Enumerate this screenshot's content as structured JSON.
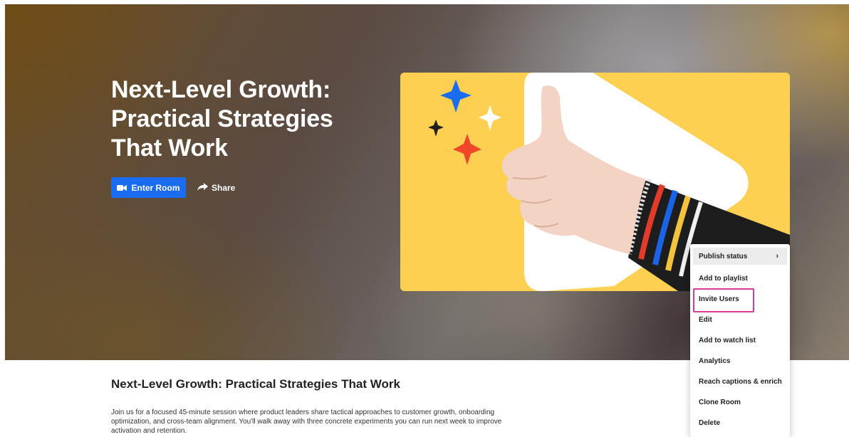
{
  "hero": {
    "title": "Next-Level Growth: Practical Strategies That Work",
    "enter_label": "Enter Room",
    "share_label": "Share"
  },
  "description": {
    "title": "Next-Level Growth: Practical Strategies That Work",
    "text": "Join us for a focused 45-minute session where product leaders share tactical approaches to customer growth, onboarding optimization, and cross-team alignment. You'll walk away with three concrete experiments you can run next week to improve activation and retention."
  },
  "menu": {
    "items": [
      {
        "label": "Publish status"
      },
      {
        "label": "Add to playlist"
      },
      {
        "label": "Invite Users"
      },
      {
        "label": "Edit"
      },
      {
        "label": "Add to watch list"
      },
      {
        "label": "Analytics"
      },
      {
        "label": "Reach captions & enrich"
      },
      {
        "label": "Clone Room"
      },
      {
        "label": "Delete"
      }
    ],
    "highlight_color": "#d63d8c"
  },
  "colors": {
    "primary_button": "#1a6cf0",
    "thumbnail_bg": "#fdd052"
  }
}
